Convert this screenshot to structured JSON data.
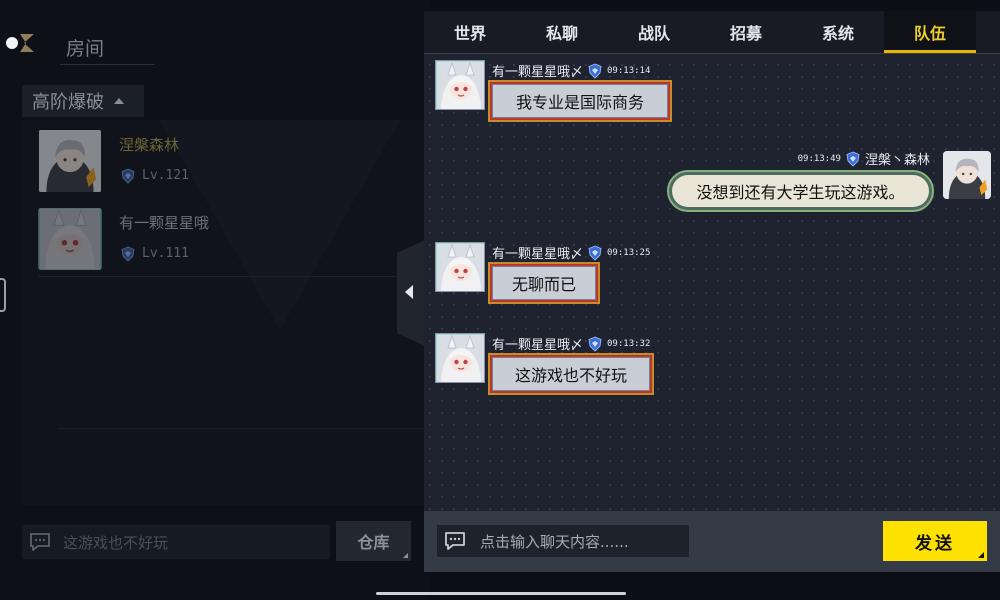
{
  "room": {
    "title": "房间",
    "mode_tab": "高阶爆破",
    "members": [
      {
        "name": "涅槃森林",
        "level": "Lv.121"
      },
      {
        "name": "有一颗星星哦",
        "level": "Lv.111"
      }
    ],
    "input_text": "这游戏也不好玩",
    "warehouse_label": "仓库"
  },
  "chat": {
    "tabs": [
      {
        "label": "世界",
        "active": false
      },
      {
        "label": "私聊",
        "active": false
      },
      {
        "label": "战队",
        "active": false
      },
      {
        "label": "招募",
        "active": false
      },
      {
        "label": "系统",
        "active": false
      },
      {
        "label": "队伍",
        "active": true
      }
    ],
    "messages": [
      {
        "sender": "有一颗星星哦〆",
        "time": "09:13:14",
        "text": "我专业是国际商务",
        "side": "left"
      },
      {
        "sender": "涅槃丶森林",
        "time": "09:13:49",
        "text": "没想到还有大学生玩这游戏。",
        "side": "right"
      },
      {
        "sender": "有一颗星星哦〆",
        "time": "09:13:25",
        "text": "无聊而已",
        "side": "left"
      },
      {
        "sender": "有一颗星星哦〆",
        "time": "09:13:32",
        "text": "这游戏也不好玩",
        "side": "left"
      }
    ],
    "input_placeholder": "点击输入聊天内容......",
    "send_label": "发送"
  },
  "colors": {
    "accent_yellow": "#ffe100",
    "active_tab_text": "#f0cf2a",
    "panel_bg": "#1f2330"
  }
}
